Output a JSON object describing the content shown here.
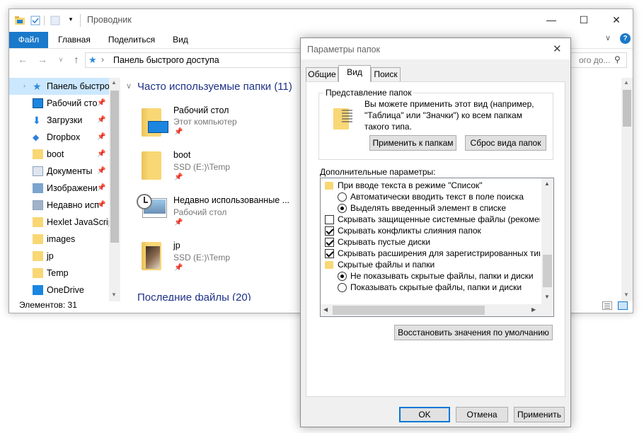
{
  "explorer": {
    "title": "Проводник",
    "ribbon_tabs": [
      "Файл",
      "Главная",
      "Поделиться",
      "Вид"
    ],
    "address": "Панель быстрого доступа",
    "search_placeholder": "ого до...",
    "nav_items": [
      {
        "label": "Панель быстрого",
        "icon": "star-icon",
        "pinned": false
      },
      {
        "label": "Рабочий сто",
        "icon": "desktop-icon",
        "pinned": true
      },
      {
        "label": "Загрузки",
        "icon": "download-icon",
        "pinned": true
      },
      {
        "label": "Dropbox",
        "icon": "dropbox-icon",
        "pinned": true
      },
      {
        "label": "boot",
        "icon": "folder-icon",
        "pinned": true
      },
      {
        "label": "Документы",
        "icon": "documents-icon",
        "pinned": true
      },
      {
        "label": "Изображени",
        "icon": "pictures-icon",
        "pinned": true
      },
      {
        "label": "Недавно исп",
        "icon": "recent-icon",
        "pinned": true
      },
      {
        "label": "Hexlet JavaScript",
        "icon": "folder-icon",
        "pinned": false
      },
      {
        "label": "images",
        "icon": "folder-icon",
        "pinned": false
      },
      {
        "label": "jp",
        "icon": "folder-icon",
        "pinned": false
      },
      {
        "label": "Temp",
        "icon": "folder-icon",
        "pinned": false
      },
      {
        "label": "OneDrive",
        "icon": "onedrive-icon",
        "pinned": false
      }
    ],
    "frequent_header": "Часто используемые папки (11)",
    "recent_header": "Последние файлы (20)",
    "items": [
      {
        "title": "Рабочий стол",
        "sub": "Этот компьютер"
      },
      {
        "title": "boot",
        "sub": "SSD (E:)\\Temp"
      },
      {
        "title": "Недавно использованные ...",
        "sub": "Рабочий стол"
      },
      {
        "title": "jp",
        "sub": "SSD (E:)\\Temp"
      }
    ],
    "status": "Элементов: 31"
  },
  "dialog": {
    "title": "Параметры папок",
    "tabs": [
      "Общие",
      "Вид",
      "Поиск"
    ],
    "group_title": "Представление папок",
    "group_text": "Вы можете применить этот вид (например, \"Таблица\" или \"Значки\") ко всем папкам такого типа.",
    "apply_to_folders": "Применить к папкам",
    "reset_folders": "Сброс вида папок",
    "advanced_label": "Дополнительные параметры:",
    "options": [
      {
        "kind": "folder",
        "indent": 0,
        "label": "При вводе текста в режиме \"Список\""
      },
      {
        "kind": "radio",
        "checked": false,
        "indent": 1,
        "label": "Автоматически вводить текст в поле поиска"
      },
      {
        "kind": "radio",
        "checked": true,
        "indent": 1,
        "label": "Выделять введенный элемент в списке"
      },
      {
        "kind": "check",
        "checked": false,
        "indent": 0,
        "label": "Скрывать защищенные системные файлы (рекомен"
      },
      {
        "kind": "check",
        "checked": true,
        "indent": 0,
        "label": "Скрывать конфликты слияния папок"
      },
      {
        "kind": "check",
        "checked": true,
        "indent": 0,
        "label": "Скрывать пустые диски"
      },
      {
        "kind": "check",
        "checked": true,
        "indent": 0,
        "label": "Скрывать расширения для зарегистрированных типо"
      },
      {
        "kind": "folder",
        "indent": 0,
        "label": "Скрытые файлы и папки"
      },
      {
        "kind": "radio",
        "checked": true,
        "indent": 1,
        "label": "Не показывать скрытые файлы, папки и диски"
      },
      {
        "kind": "radio",
        "checked": false,
        "indent": 1,
        "label": "Показывать скрытые файлы, папки и диски"
      }
    ],
    "restore_defaults": "Восстановить значения по умолчанию",
    "ok": "OK",
    "cancel": "Отмена",
    "apply": "Применить"
  },
  "colors": {
    "accent": "#0078d7",
    "folder": "#f8d775",
    "header": "#1e3287"
  }
}
